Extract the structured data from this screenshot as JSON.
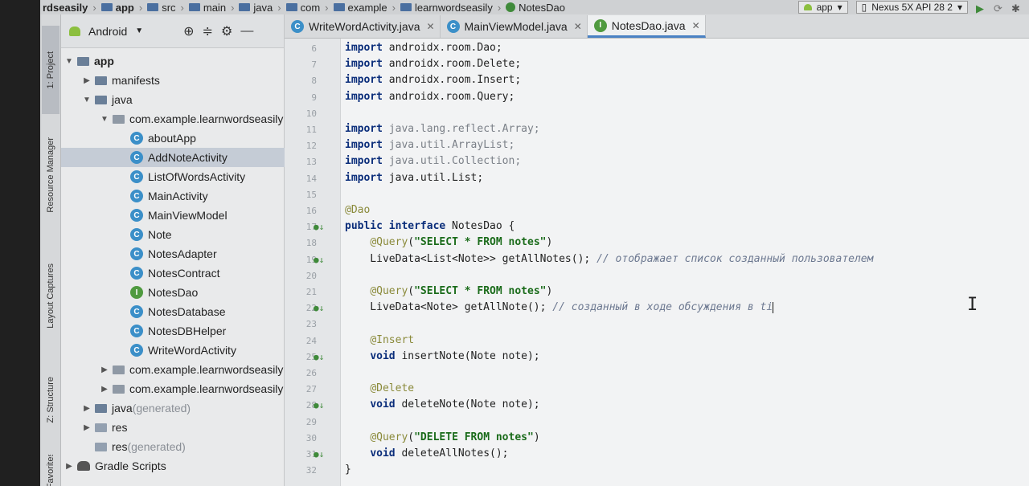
{
  "breadcrumb": {
    "items": [
      "rdseasily",
      "app",
      "src",
      "main",
      "java",
      "com",
      "example",
      "learnwordseasily",
      "NotesDao"
    ],
    "run_config": "app",
    "device": "Nexus 5X API 28 2"
  },
  "tool_strip": {
    "tabs": [
      "1: Project",
      "Resource Manager",
      "Layout Captures",
      "Z: Structure",
      "Favorites"
    ]
  },
  "project_panel": {
    "view_selector": "Android",
    "tree": [
      {
        "label": "app",
        "depth": 0,
        "kind": "module",
        "expanded": true
      },
      {
        "label": "manifests",
        "depth": 1,
        "kind": "folder",
        "expanded": false
      },
      {
        "label": "java",
        "depth": 1,
        "kind": "folder",
        "expanded": true
      },
      {
        "label": "com.example.learnwordseasily",
        "depth": 2,
        "kind": "package",
        "expanded": true
      },
      {
        "label": "aboutApp",
        "depth": 3,
        "kind": "class"
      },
      {
        "label": "AddNoteActivity",
        "depth": 3,
        "kind": "class",
        "selected": true
      },
      {
        "label": "ListOfWordsActivity",
        "depth": 3,
        "kind": "class"
      },
      {
        "label": "MainActivity",
        "depth": 3,
        "kind": "class"
      },
      {
        "label": "MainViewModel",
        "depth": 3,
        "kind": "class"
      },
      {
        "label": "Note",
        "depth": 3,
        "kind": "class"
      },
      {
        "label": "NotesAdapter",
        "depth": 3,
        "kind": "class"
      },
      {
        "label": "NotesContract",
        "depth": 3,
        "kind": "class"
      },
      {
        "label": "NotesDao",
        "depth": 3,
        "kind": "interface"
      },
      {
        "label": "NotesDatabase",
        "depth": 3,
        "kind": "class"
      },
      {
        "label": "NotesDBHelper",
        "depth": 3,
        "kind": "class"
      },
      {
        "label": "WriteWordActivity",
        "depth": 3,
        "kind": "class"
      },
      {
        "label": "com.example.learnwordseasily",
        "depth": 2,
        "kind": "package",
        "expanded": false
      },
      {
        "label": "com.example.learnwordseasily",
        "depth": 2,
        "kind": "package",
        "expanded": false
      },
      {
        "label": "java",
        "suffix": "(generated)",
        "depth": 1,
        "kind": "folder",
        "expanded": false
      },
      {
        "label": "res",
        "depth": 1,
        "kind": "res",
        "expanded": false
      },
      {
        "label": "res",
        "suffix": "(generated)",
        "depth": 1,
        "kind": "res",
        "expanded": null
      },
      {
        "label": "Gradle Scripts",
        "depth": 0,
        "kind": "gradle",
        "expanded": false
      }
    ]
  },
  "editor": {
    "tabs": [
      {
        "label": "WriteWordActivity.java",
        "kind": "class",
        "active": false
      },
      {
        "label": "MainViewModel.java",
        "kind": "class",
        "active": false
      },
      {
        "label": "NotesDao.java",
        "kind": "interface",
        "active": true
      }
    ],
    "lines": [
      {
        "n": "6",
        "mark": "",
        "segs": [
          [
            "kw",
            "import"
          ],
          [
            "pk",
            " androidx.room.Dao;"
          ]
        ]
      },
      {
        "n": "7",
        "mark": "",
        "segs": [
          [
            "kw",
            "import"
          ],
          [
            "pk",
            " androidx.room.Delete;"
          ]
        ]
      },
      {
        "n": "8",
        "mark": "",
        "segs": [
          [
            "kw",
            "import"
          ],
          [
            "pk",
            " androidx.room.Insert;"
          ]
        ]
      },
      {
        "n": "9",
        "mark": "",
        "segs": [
          [
            "kw",
            "import"
          ],
          [
            "pk",
            " androidx.room.Query;"
          ]
        ]
      },
      {
        "n": "10",
        "mark": "",
        "segs": []
      },
      {
        "n": "11",
        "mark": "",
        "segs": [
          [
            "kw",
            "import"
          ],
          [
            "pkg-gray",
            " java.lang.reflect.Array;"
          ]
        ]
      },
      {
        "n": "12",
        "mark": "",
        "segs": [
          [
            "kw",
            "import"
          ],
          [
            "pkg-gray",
            " java.util.ArrayList;"
          ]
        ]
      },
      {
        "n": "13",
        "mark": "",
        "segs": [
          [
            "kw",
            "import"
          ],
          [
            "pkg-gray",
            " java.util.Collection;"
          ]
        ]
      },
      {
        "n": "14",
        "mark": "",
        "segs": [
          [
            "kw",
            "import"
          ],
          [
            "pk",
            " java.util.List;"
          ]
        ]
      },
      {
        "n": "15",
        "mark": "",
        "segs": []
      },
      {
        "n": "16",
        "mark": "",
        "segs": [
          [
            "ann",
            "@Dao"
          ]
        ]
      },
      {
        "n": "17",
        "mark": "●↓",
        "segs": [
          [
            "kw",
            "public interface"
          ],
          [
            "pk",
            " NotesDao {"
          ]
        ]
      },
      {
        "n": "18",
        "mark": "",
        "segs": [
          [
            "pk",
            "    "
          ],
          [
            "ann",
            "@Query"
          ],
          [
            "pk",
            "("
          ],
          [
            "str",
            "\"SELECT * FROM notes\""
          ],
          [
            "pk",
            ")"
          ]
        ]
      },
      {
        "n": "19",
        "mark": "●↓",
        "segs": [
          [
            "pk",
            "    LiveData<List<Note>> getAllNotes(); "
          ],
          [
            "cmt",
            "// отображает список созданный пользователем"
          ]
        ]
      },
      {
        "n": "20",
        "mark": "",
        "segs": []
      },
      {
        "n": "21",
        "mark": "",
        "segs": [
          [
            "pk",
            "    "
          ],
          [
            "ann",
            "@Query"
          ],
          [
            "pk",
            "("
          ],
          [
            "str",
            "\"SELECT * FROM notes\""
          ],
          [
            "pk",
            ")"
          ]
        ]
      },
      {
        "n": "22",
        "mark": "●↓",
        "segs": [
          [
            "pk",
            "    LiveData<Note> getAllNote(); "
          ],
          [
            "cmt",
            "// созданный в ходе обсуждения в ti"
          ]
        ]
      },
      {
        "n": "23",
        "mark": "",
        "segs": []
      },
      {
        "n": "24",
        "mark": "",
        "segs": [
          [
            "pk",
            "    "
          ],
          [
            "ann",
            "@Insert"
          ]
        ]
      },
      {
        "n": "25",
        "mark": "●↓",
        "segs": [
          [
            "pk",
            "    "
          ],
          [
            "kw",
            "void"
          ],
          [
            "pk",
            " insertNote(Note note);"
          ]
        ]
      },
      {
        "n": "26",
        "mark": "",
        "segs": []
      },
      {
        "n": "27",
        "mark": "",
        "segs": [
          [
            "pk",
            "    "
          ],
          [
            "ann",
            "@Delete"
          ]
        ]
      },
      {
        "n": "28",
        "mark": "●↓",
        "segs": [
          [
            "pk",
            "    "
          ],
          [
            "kw",
            "void"
          ],
          [
            "pk",
            " deleteNote(Note note);"
          ]
        ]
      },
      {
        "n": "29",
        "mark": "",
        "segs": []
      },
      {
        "n": "30",
        "mark": "",
        "segs": [
          [
            "pk",
            "    "
          ],
          [
            "ann",
            "@Query"
          ],
          [
            "pk",
            "("
          ],
          [
            "str",
            "\"DELETE FROM notes\""
          ],
          [
            "pk",
            ")"
          ]
        ]
      },
      {
        "n": "31",
        "mark": "●↓",
        "segs": [
          [
            "pk",
            "    "
          ],
          [
            "kw",
            "void"
          ],
          [
            "pk",
            " deleteAllNotes();"
          ]
        ]
      },
      {
        "n": "32",
        "mark": "",
        "segs": [
          [
            "pk",
            "}"
          ]
        ]
      }
    ],
    "caret_line": "22"
  }
}
